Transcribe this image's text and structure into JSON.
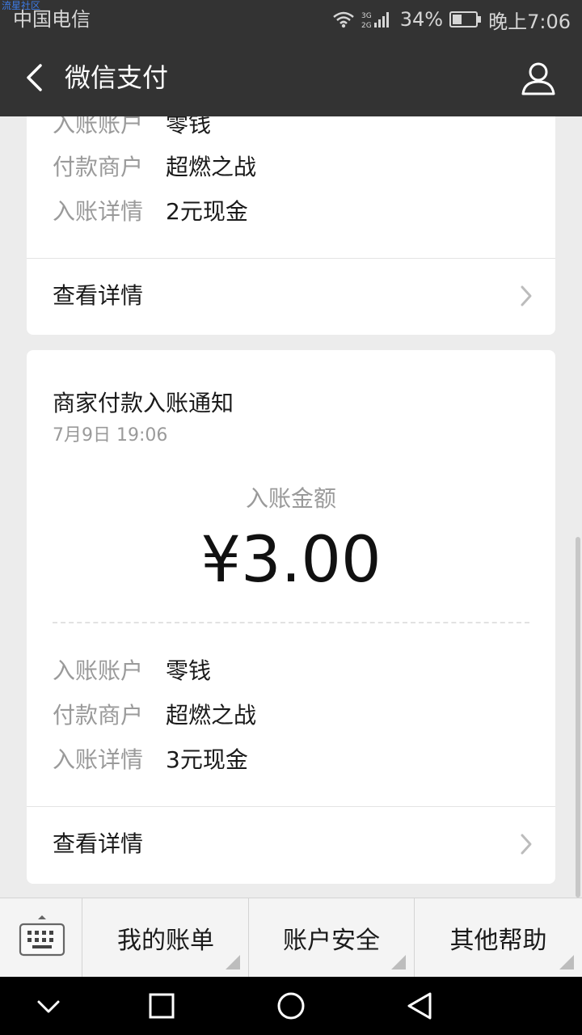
{
  "status_bar": {
    "watermark": "流星社区",
    "carrier": "中国电信",
    "network": "3G 2G",
    "battery": "34%",
    "time": "晚上7:06"
  },
  "header": {
    "title": "微信支付",
    "back_icon": "chevron-left-icon",
    "profile_icon": "user-profile-icon"
  },
  "cards": [
    {
      "rows": [
        {
          "label": "入账账户",
          "value": "零钱"
        },
        {
          "label": "付款商户",
          "value": "超燃之战"
        },
        {
          "label": "入账详情",
          "value": "2元现金"
        }
      ],
      "link_label": "查看详情"
    },
    {
      "title": "商家付款入账通知",
      "time": "7月9日  19:06",
      "amount_label": "入账金额",
      "amount": "¥3.00",
      "rows": [
        {
          "label": "入账账户",
          "value": "零钱"
        },
        {
          "label": "付款商户",
          "value": "超燃之战"
        },
        {
          "label": "入账详情",
          "value": "3元现金"
        }
      ],
      "link_label": "查看详情"
    }
  ],
  "bottom_menu": {
    "keyboard_icon": "keyboard-icon",
    "items": [
      "我的账单",
      "账户安全",
      "其他帮助"
    ]
  },
  "system_nav": [
    "collapse-icon",
    "recents-icon",
    "home-icon",
    "back-icon"
  ]
}
